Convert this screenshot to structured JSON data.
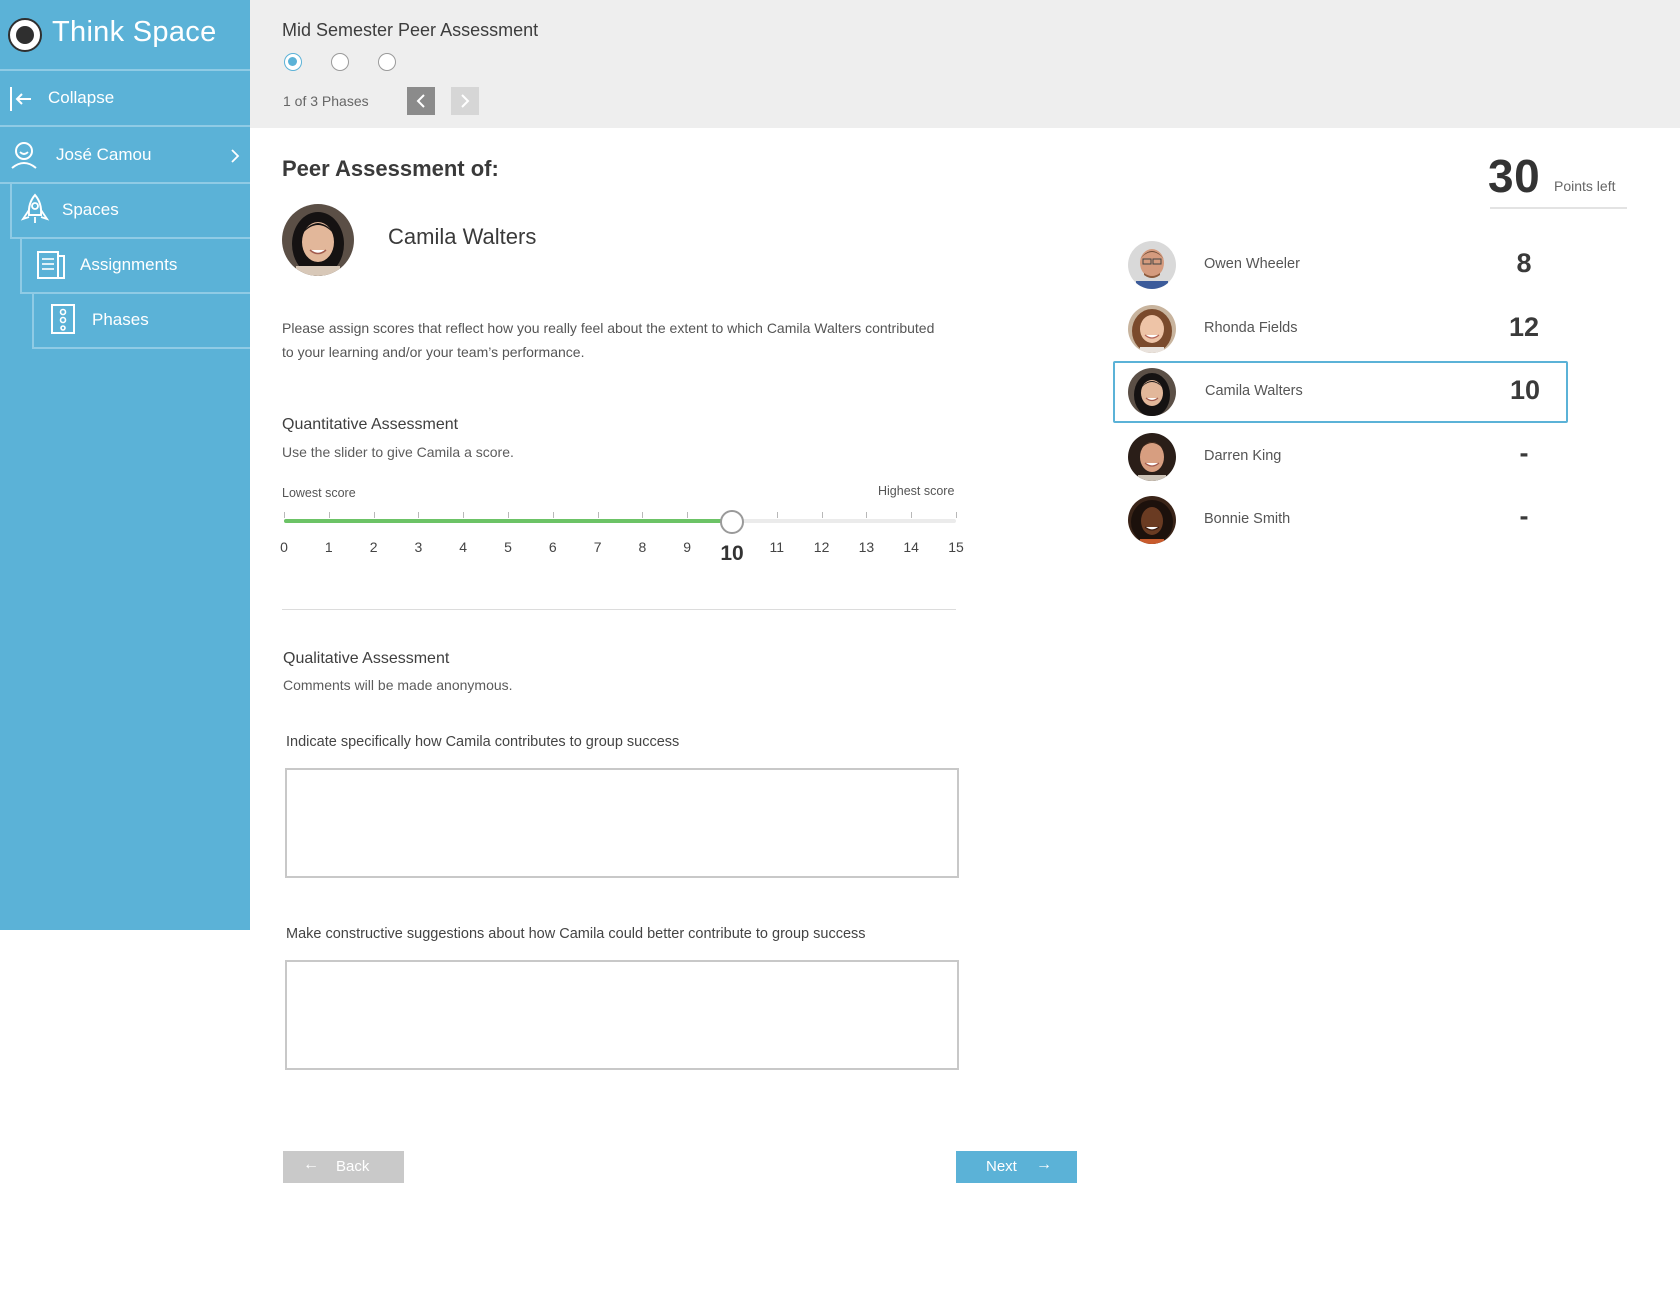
{
  "app": {
    "title": "Think Space"
  },
  "sidebar": {
    "items": [
      {
        "label": "Collapse",
        "icon": "collapse-icon"
      },
      {
        "label": "José Camou",
        "icon": "user-icon"
      },
      {
        "label": "Spaces",
        "icon": "rocket-icon"
      },
      {
        "label": "Assignments",
        "icon": "assignments-icon"
      },
      {
        "label": "Phases",
        "icon": "phases-icon"
      }
    ]
  },
  "header": {
    "assessment_title": "Mid Semester Peer Assessment",
    "phase_indicator": "1 of 3 Phases",
    "phases": 3,
    "current_phase": 1
  },
  "main": {
    "heading": "Peer Assessment of:",
    "subject_name": "Camila Walters",
    "instructions": "Please assign scores that reflect how you really feel about the extent to which Camila Walters contributed to your learning and/or your team’s performance.",
    "quantitative": {
      "title": "Quantitative Assessment",
      "subtitle": "Use the slider to give Camila a score.",
      "lowest_label": "Lowest score",
      "highest_label": "Highest score",
      "min": 0,
      "max": 15,
      "value": 10,
      "ticks": [
        "0",
        "1",
        "2",
        "3",
        "4",
        "5",
        "6",
        "7",
        "8",
        "9",
        "10",
        "11",
        "12",
        "13",
        "14",
        "15"
      ]
    },
    "qualitative": {
      "title": "Qualitative Assessment",
      "subtitle": "Comments will be made anonymous.",
      "prompt1": "Indicate specifically how  Camila contributes to group success",
      "answer1": "",
      "prompt2": "Make constructive suggestions about how Camila could better contribute to group success",
      "answer2": ""
    },
    "back_label": "Back",
    "next_label": "Next"
  },
  "points": {
    "value": "30",
    "label": "Points left"
  },
  "peers": [
    {
      "name": "Owen Wheeler",
      "score": "8",
      "selected": false
    },
    {
      "name": "Rhonda Fields",
      "score": "12",
      "selected": false
    },
    {
      "name": "Camila Walters",
      "score": "10",
      "selected": true
    },
    {
      "name": "Darren King",
      "score": "-",
      "selected": false
    },
    {
      "name": "Bonnie Smith",
      "score": "-",
      "selected": false
    }
  ],
  "colors": {
    "accent": "#5bb2d7",
    "slider_fill": "#6cc366",
    "sidebar_bg": "#5bb2d7",
    "header_bg": "#eeeeee",
    "disabled": "#c9c9c9"
  }
}
